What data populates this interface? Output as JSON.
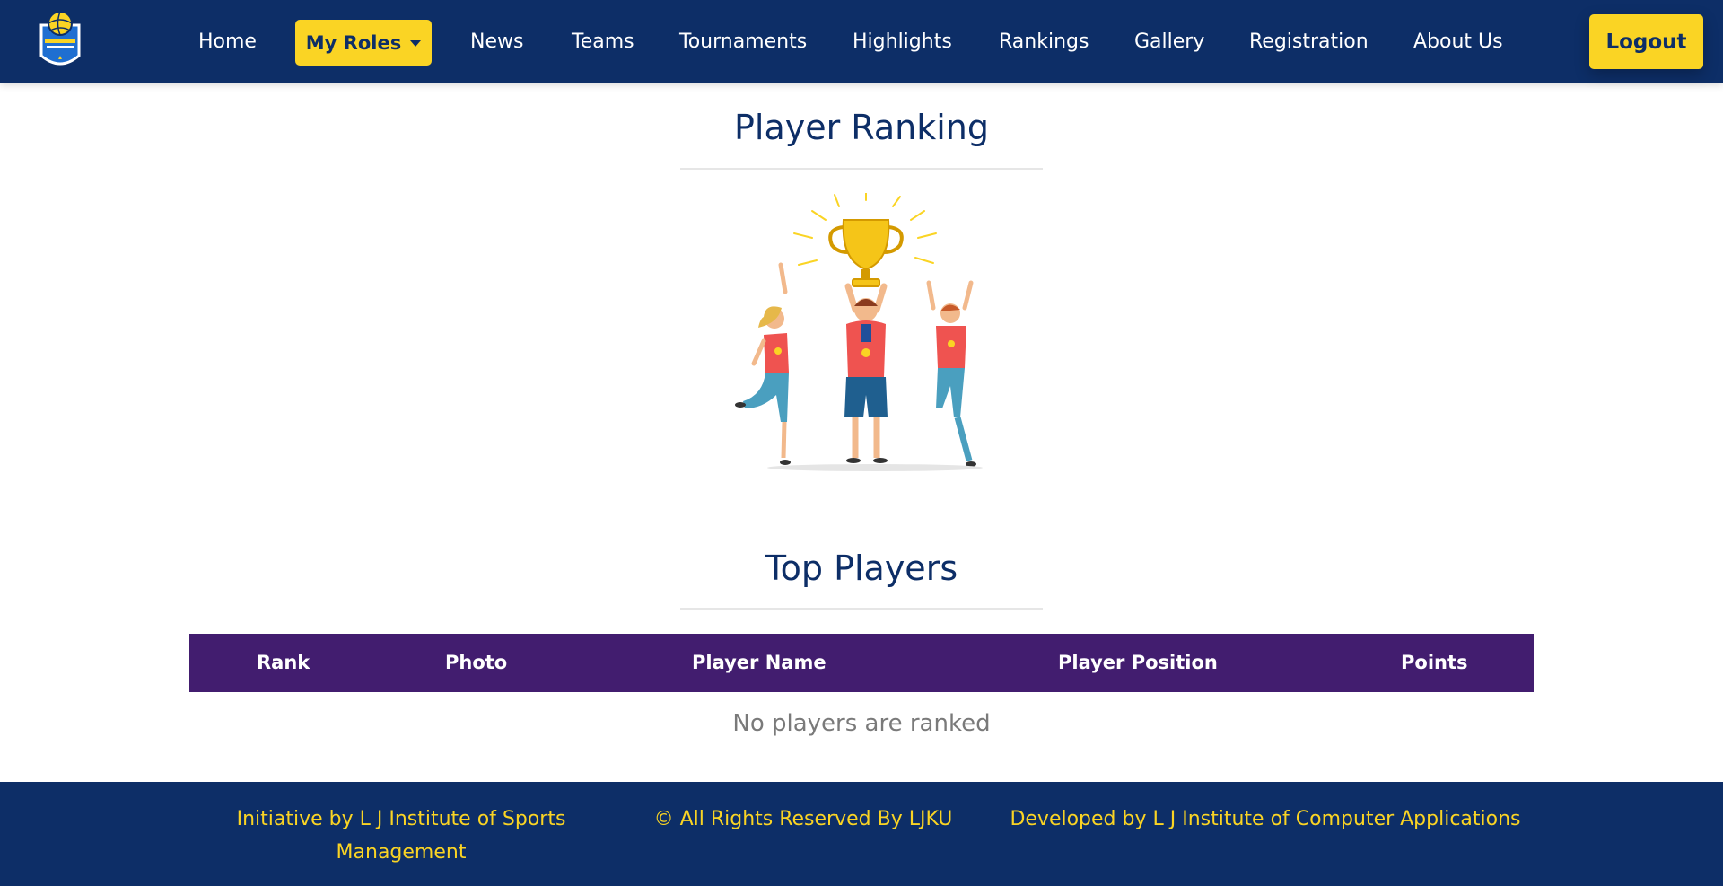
{
  "nav": {
    "home": "Home",
    "my_roles": "My Roles",
    "news": "News",
    "teams": "Teams",
    "tournaments": "Tournaments",
    "highlights": "Highlights",
    "rankings": "Rankings",
    "gallery": "Gallery",
    "registration": "Registration",
    "about_us": "About Us",
    "logout": "Logout"
  },
  "hero": {
    "title": "Player Ranking",
    "illustration": "trophy-celebration-illustration"
  },
  "top_players": {
    "title": "Top Players",
    "columns": [
      "Rank",
      "Photo",
      "Player Name",
      "Player Position",
      "Points"
    ],
    "rows": [],
    "empty_message": "No players are ranked"
  },
  "footer": {
    "initiative": "Initiative by L J Institute of Sports Management",
    "rights": "© All Rights Reserved By LJKU",
    "developed": "Developed by L J Institute of Computer Applications"
  },
  "colors": {
    "navy": "#0d2e67",
    "accent_yellow": "#fad424",
    "table_header_purple": "#421d6f",
    "muted_text": "#7a7a7a"
  }
}
